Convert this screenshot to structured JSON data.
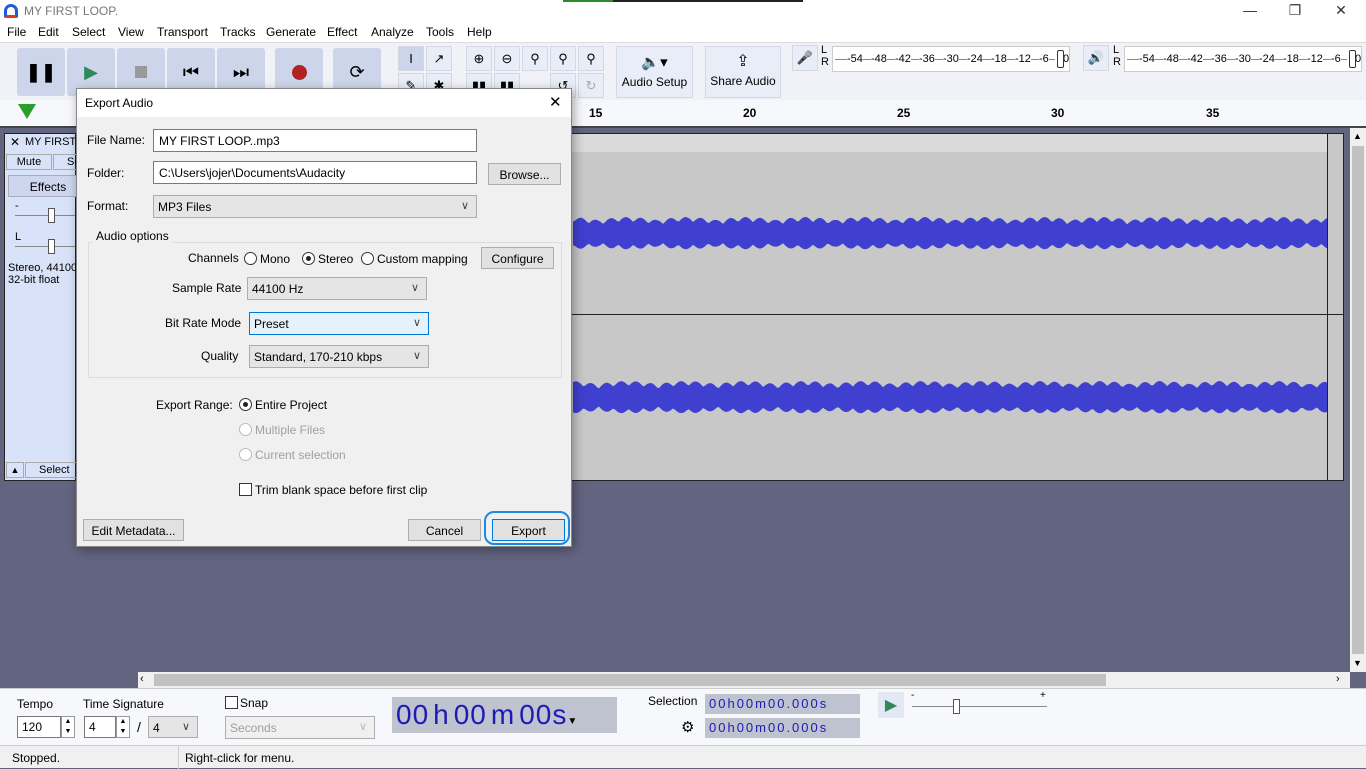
{
  "window": {
    "title": "MY FIRST LOOP."
  },
  "menu": [
    "File",
    "Edit",
    "Select",
    "View",
    "Transport",
    "Tracks",
    "Generate",
    "Effect",
    "Analyze",
    "Tools",
    "Help"
  ],
  "toolbar": {
    "audio_setup": "Audio Setup",
    "share_audio": "Share Audio",
    "record_meter_ticks": [
      "-54",
      "-48",
      "-42",
      "-36",
      "-30",
      "-24",
      "-18",
      "-12",
      "-6",
      "0"
    ],
    "play_meter_ticks": [
      "-54",
      "-48",
      "-42",
      "-36",
      "-30",
      "-24",
      "-18",
      "-12",
      "-6",
      "0"
    ],
    "lr": [
      "L",
      "R"
    ]
  },
  "ruler": {
    "ticks": [
      "15",
      "20",
      "25",
      "30",
      "35"
    ]
  },
  "track": {
    "name": "MY FIRST LOOP.",
    "mute": "Mute",
    "solo": "Solo",
    "effects": "Effects",
    "gain_label": "-",
    "pan_label": "L",
    "info1": "Stereo, 44100Hz",
    "info2": "32-bit float",
    "select": "Select",
    "wave_color": "#3f3fd0"
  },
  "dialog": {
    "title": "Export Audio",
    "file_name_label": "File Name:",
    "file_name": "MY FIRST LOOP..mp3",
    "folder_label": "Folder:",
    "folder": "C:\\Users\\jojer\\Documents\\Audacity",
    "browse": "Browse...",
    "format_label": "Format:",
    "format": "MP3 Files",
    "audio_options": "Audio options",
    "channels_label": "Channels",
    "mono": "Mono",
    "stereo": "Stereo",
    "custom": "Custom mapping",
    "configure": "Configure",
    "sample_rate_label": "Sample Rate",
    "sample_rate": "44100 Hz",
    "bit_rate_mode_label": "Bit Rate Mode",
    "bit_rate_mode": "Preset",
    "quality_label": "Quality",
    "quality": "Standard, 170-210 kbps",
    "export_range_label": "Export Range:",
    "entire_project": "Entire Project",
    "multiple_files": "Multiple Files",
    "current_selection": "Current selection",
    "trim": "Trim blank space before first clip",
    "edit_metadata": "Edit Metadata...",
    "cancel": "Cancel",
    "export": "Export"
  },
  "bottom": {
    "tempo_label": "Tempo",
    "tempo": "120",
    "time_sig_label": "Time Signature",
    "time_sig_num": "4",
    "time_sig_den": "4",
    "snap": "Snap",
    "snap_unit": "Seconds",
    "time": {
      "h": "00",
      "hl": "h",
      "m": "00",
      "ml": "m",
      "s": "00",
      "sl": "s"
    },
    "selection_label": "Selection",
    "sel_start": "00h00m00.000s",
    "sel_end": "00h00m00.000s",
    "speed_min": "-",
    "speed_max": "+"
  },
  "status": {
    "state": "Stopped.",
    "hint": "Right-click for menu."
  }
}
